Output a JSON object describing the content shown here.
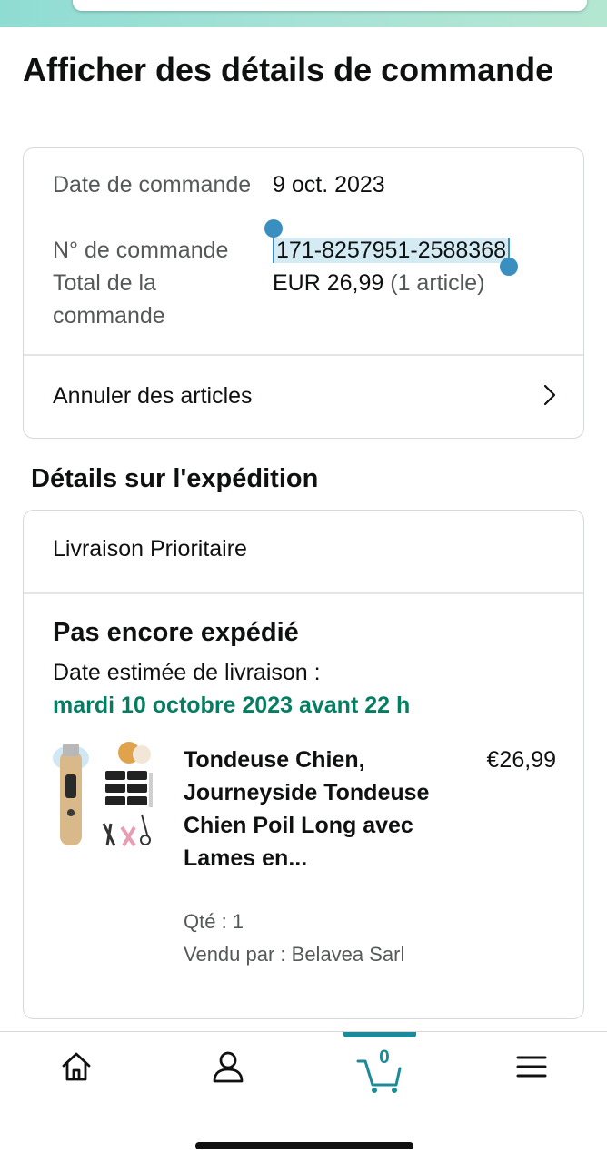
{
  "page_title": "Afficher des détails de commande",
  "order_summary": {
    "date_label": "Date de commande",
    "date_value": "9 oct. 2023",
    "number_label": "N° de commande",
    "number_value": "171-8257951-2588368",
    "total_label": "Total de la commande",
    "total_value": "EUR 26,99",
    "total_items": "(1 article)"
  },
  "cancel_items_label": "Annuler des articles",
  "shipping": {
    "section_title": "Détails sur l'expédition",
    "method": "Livraison Prioritaire",
    "status": "Pas encore expédié",
    "estimate_label": "Date estimée de livraison :",
    "estimate_date": "mardi 10 octobre 2023 avant 22 h"
  },
  "product": {
    "title": "Tondeuse Chien, Journeyside Tondeuse Chien Poil Long avec Lames en...",
    "price": "€26,99",
    "quantity": "Qté : 1",
    "seller": "Vendu par : Belavea Sarl"
  },
  "bottom_nav": {
    "items": [
      "home-icon",
      "account-icon",
      "cart-icon",
      "menu-icon"
    ],
    "cart_count": "0",
    "active": "cart-icon",
    "accent_color": "#1d8a99"
  },
  "colors": {
    "delivery_green": "#067d62",
    "selection_blue": "#3a8fc0"
  }
}
